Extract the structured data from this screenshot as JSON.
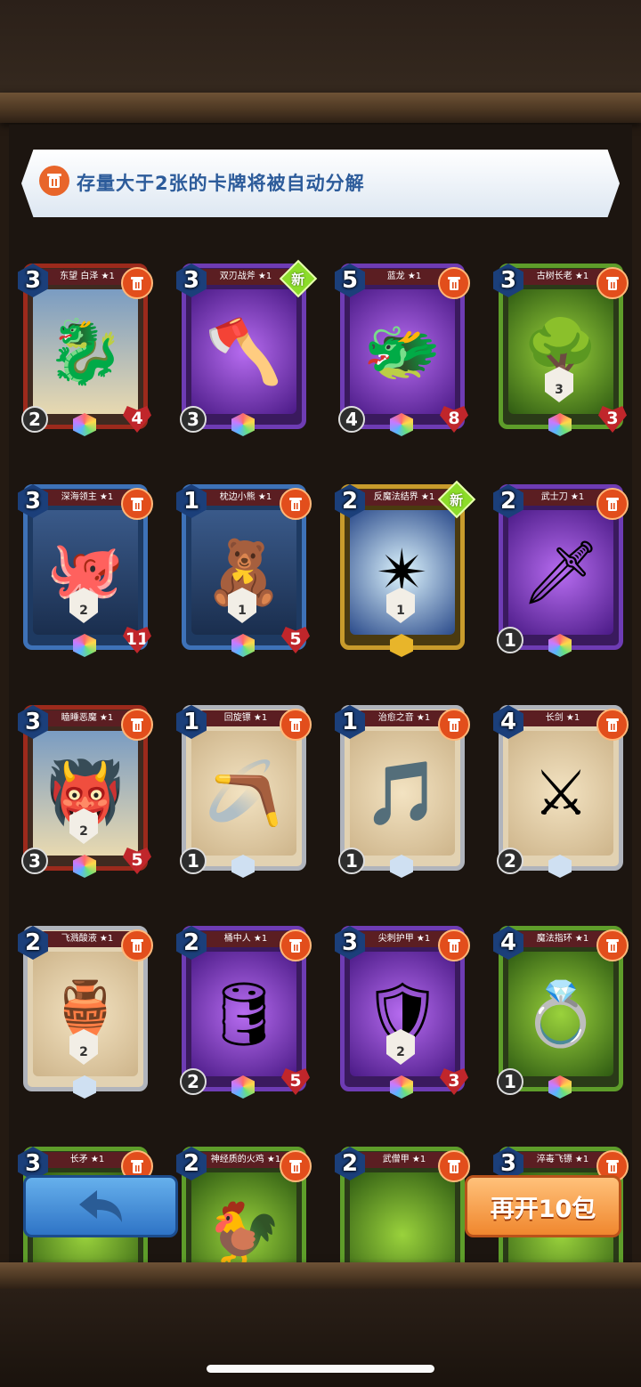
{
  "notice": {
    "text": "存量大于2张的卡牌将被自动分解",
    "icon": "trash-icon"
  },
  "colors": {
    "trash": "#e24e1c",
    "new_badge": "#8cdc2a",
    "back_button": "#2f74c6",
    "more_button": "#f0872e"
  },
  "cards": [
    {
      "name": "东望 白泽 ★1",
      "cost": "3",
      "attack": "2",
      "hp": "4",
      "center": "",
      "badge": "",
      "frame": "red",
      "art": "🐉"
    },
    {
      "name": "双刃战斧 ★1",
      "cost": "3",
      "attack": "3",
      "hp": "",
      "center": "",
      "badge": "新",
      "frame": "purple",
      "art": "🪓"
    },
    {
      "name": "蓝龙 ★1",
      "cost": "5",
      "attack": "4",
      "hp": "8",
      "center": "",
      "badge": "",
      "frame": "purple",
      "art": "🐲"
    },
    {
      "name": "古树长老 ★1",
      "cost": "3",
      "attack": "",
      "hp": "3",
      "center": "3",
      "badge": "",
      "frame": "green",
      "art": "🌳"
    },
    {
      "name": "深海领主 ★1",
      "cost": "3",
      "attack": "",
      "hp": "11",
      "center": "2",
      "badge": "",
      "frame": "blue",
      "art": "🐙"
    },
    {
      "name": "枕边小熊 ★1",
      "cost": "1",
      "attack": "",
      "hp": "5",
      "center": "1",
      "badge": "",
      "frame": "blue",
      "art": "🧸"
    },
    {
      "name": "反魔法结界 ★1",
      "cost": "2",
      "attack": "",
      "hp": "",
      "center": "1",
      "badge": "新",
      "frame": "gold",
      "art": "✴"
    },
    {
      "name": "武士刀 ★1",
      "cost": "2",
      "attack": "1",
      "hp": "",
      "center": "",
      "badge": "",
      "frame": "purple",
      "art": "🗡"
    },
    {
      "name": "瞌睡恶魔 ★1",
      "cost": "3",
      "attack": "3",
      "hp": "5",
      "center": "2",
      "badge": "",
      "frame": "red",
      "art": "👹"
    },
    {
      "name": "回旋镖 ★1",
      "cost": "1",
      "attack": "1",
      "hp": "",
      "center": "",
      "badge": "",
      "frame": "silver",
      "art": "🪃"
    },
    {
      "name": "治愈之音 ★1",
      "cost": "1",
      "attack": "1",
      "hp": "",
      "center": "",
      "badge": "",
      "frame": "silver",
      "art": "🎵"
    },
    {
      "name": "长剑 ★1",
      "cost": "4",
      "attack": "2",
      "hp": "",
      "center": "",
      "badge": "",
      "frame": "silver",
      "art": "⚔"
    },
    {
      "name": "飞溅酸液 ★1",
      "cost": "2",
      "attack": "",
      "hp": "",
      "center": "2",
      "badge": "",
      "frame": "silver",
      "art": "🏺"
    },
    {
      "name": "桶中人 ★1",
      "cost": "2",
      "attack": "2",
      "hp": "5",
      "center": "",
      "badge": "",
      "frame": "purple",
      "art": "🛢"
    },
    {
      "name": "尖刺护甲 ★1",
      "cost": "3",
      "attack": "",
      "hp": "3",
      "center": "2",
      "badge": "",
      "frame": "purple",
      "art": "🛡"
    },
    {
      "name": "魔法指环 ★1",
      "cost": "4",
      "attack": "1",
      "hp": "",
      "center": "",
      "badge": "",
      "frame": "green",
      "art": "💍"
    },
    {
      "name": "长矛 ★1",
      "cost": "3",
      "attack": "",
      "hp": "",
      "center": "",
      "badge": "",
      "frame": "green",
      "art": ""
    },
    {
      "name": "神经质的火鸡 ★1",
      "cost": "2",
      "attack": "",
      "hp": "",
      "center": "",
      "badge": "",
      "frame": "green",
      "art": "🐓"
    },
    {
      "name": "武僧甲 ★1",
      "cost": "2",
      "attack": "",
      "hp": "",
      "center": "",
      "badge": "",
      "frame": "green",
      "art": ""
    },
    {
      "name": "淬毒飞镖 ★1",
      "cost": "3",
      "attack": "",
      "hp": "",
      "center": "",
      "badge": "",
      "frame": "green",
      "art": ""
    }
  ],
  "buttons": {
    "back_icon": "back-arrow-icon",
    "open_more": "再开10包"
  }
}
